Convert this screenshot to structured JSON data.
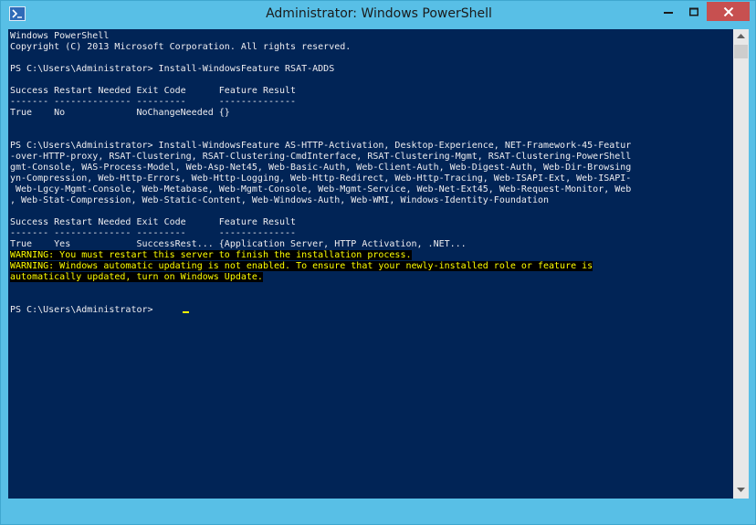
{
  "window": {
    "title": "Administrator: Windows PowerShell",
    "accent_color": "#5cc0e6",
    "close_color": "#c75050",
    "icon": "powershell-icon",
    "buttons": [
      "minimize-icon",
      "maximize-icon",
      "close-icon"
    ]
  },
  "console": {
    "background": "#012456",
    "text_color": "#eeedf0",
    "warning_color": "#ffff00",
    "lines": [
      {
        "text": "Windows PowerShell",
        "type": "normal"
      },
      {
        "text": "Copyright (C) 2013 Microsoft Corporation. All rights reserved.",
        "type": "normal"
      },
      {
        "text": "",
        "type": "normal"
      },
      {
        "text": "PS C:\\Users\\Administrator> Install-WindowsFeature RSAT-ADDS",
        "type": "normal"
      },
      {
        "text": "",
        "type": "normal"
      },
      {
        "text": "Success Restart Needed Exit Code      Feature Result",
        "type": "normal"
      },
      {
        "text": "------- -------------- ---------      --------------",
        "type": "normal"
      },
      {
        "text": "True    No             NoChangeNeeded {}",
        "type": "normal"
      },
      {
        "text": "",
        "type": "normal"
      },
      {
        "text": "",
        "type": "normal"
      },
      {
        "text": "PS C:\\Users\\Administrator> Install-WindowsFeature AS-HTTP-Activation, Desktop-Experience, NET-Framework-45-Featur",
        "type": "normal"
      },
      {
        "text": "-over-HTTP-proxy, RSAT-Clustering, RSAT-Clustering-CmdInterface, RSAT-Clustering-Mgmt, RSAT-Clustering-PowerShell",
        "type": "normal"
      },
      {
        "text": "gmt-Console, WAS-Process-Model, Web-Asp-Net45, Web-Basic-Auth, Web-Client-Auth, Web-Digest-Auth, Web-Dir-Browsing",
        "type": "normal"
      },
      {
        "text": "yn-Compression, Web-Http-Errors, Web-Http-Logging, Web-Http-Redirect, Web-Http-Tracing, Web-ISAPI-Ext, Web-ISAPI-",
        "type": "normal"
      },
      {
        "text": " Web-Lgcy-Mgmt-Console, Web-Metabase, Web-Mgmt-Console, Web-Mgmt-Service, Web-Net-Ext45, Web-Request-Monitor, Web",
        "type": "normal"
      },
      {
        "text": ", Web-Stat-Compression, Web-Static-Content, Web-Windows-Auth, Web-WMI, Windows-Identity-Foundation",
        "type": "normal"
      },
      {
        "text": "",
        "type": "normal"
      },
      {
        "text": "Success Restart Needed Exit Code      Feature Result",
        "type": "normal"
      },
      {
        "text": "------- -------------- ---------      --------------",
        "type": "normal"
      },
      {
        "text": "True    Yes            SuccessRest... {Application Server, HTTP Activation, .NET...",
        "type": "normal"
      },
      {
        "text": "WARNING: You must restart this server to finish the installation process.",
        "type": "warn"
      },
      {
        "text": "WARNING: Windows automatic updating is not enabled. To ensure that your newly-installed role or feature is",
        "type": "warn"
      },
      {
        "text": "automatically updated, turn on Windows Update.",
        "type": "warn"
      },
      {
        "text": "",
        "type": "normal"
      },
      {
        "text": "",
        "type": "normal"
      },
      {
        "text": "PS C:\\Users\\Administrator>",
        "type": "normal"
      }
    ]
  }
}
